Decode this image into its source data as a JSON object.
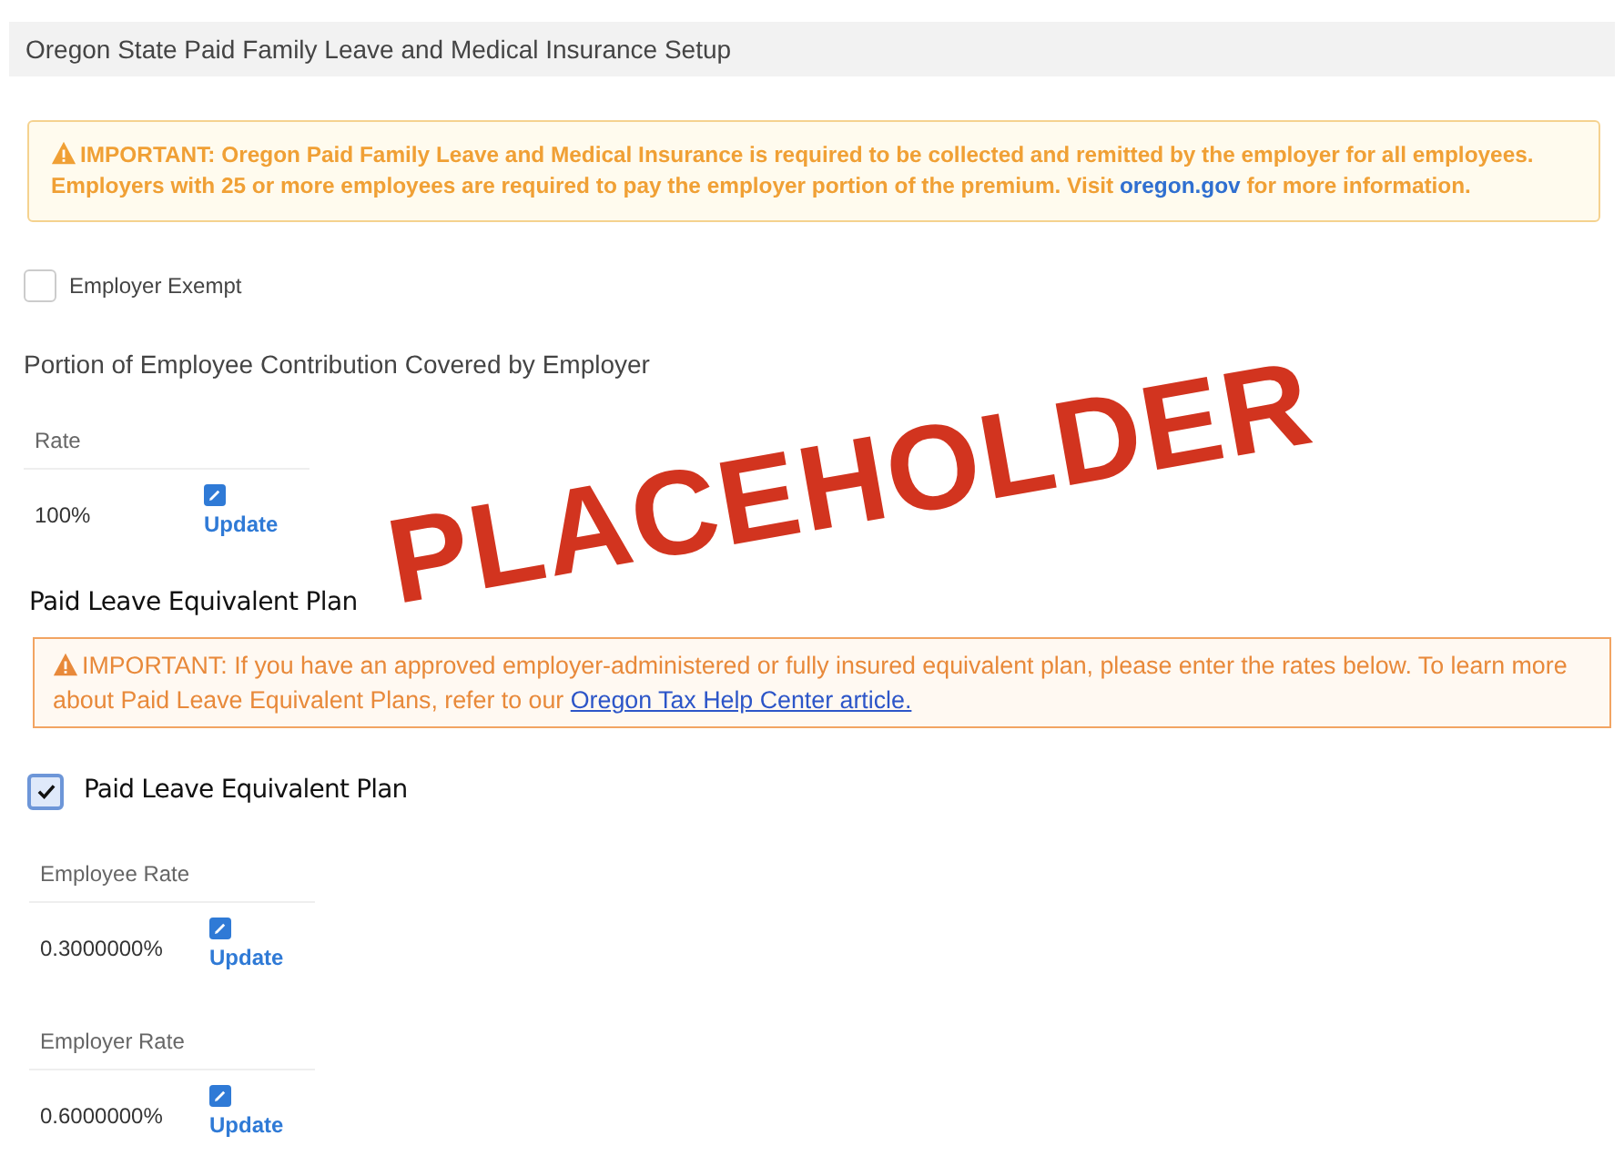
{
  "header": {
    "title": "Oregon State Paid Family Leave and Medical Insurance Setup"
  },
  "notice": {
    "text_before": "IMPORTANT: Oregon Paid Family Leave and Medical Insurance is required to be collected and remitted by the employer for all employees. Employers with 25 or more employees are required to pay the employer portion of the premium. Visit ",
    "link": "oregon.gov",
    "text_after": " for more information."
  },
  "exempt": {
    "label": "Employer Exempt",
    "checked": false
  },
  "contribution": {
    "heading": "Portion of Employee Contribution Covered by Employer",
    "rates": [
      {
        "label": "Rate",
        "value": "100%",
        "action": "Update"
      }
    ]
  },
  "stamp": "PLACEHOLDER",
  "equivalent": {
    "heading": "Paid Leave Equivalent Plan",
    "notice": {
      "text_before": "IMPORTANT:  If you have an approved employer-administered or fully insured equivalent plan, please enter the rates below.  To learn more about Paid Leave Equivalent Plans, refer to our ",
      "link": "Oregon Tax Help Center article."
    },
    "plan": {
      "label": "Paid Leave Equivalent Plan",
      "checked": true
    },
    "rates": [
      {
        "label": "Employee Rate",
        "value": "0.3000000%",
        "action": "Update"
      },
      {
        "label": "Employer Rate",
        "value": "0.6000000%",
        "action": "Update"
      }
    ]
  }
}
